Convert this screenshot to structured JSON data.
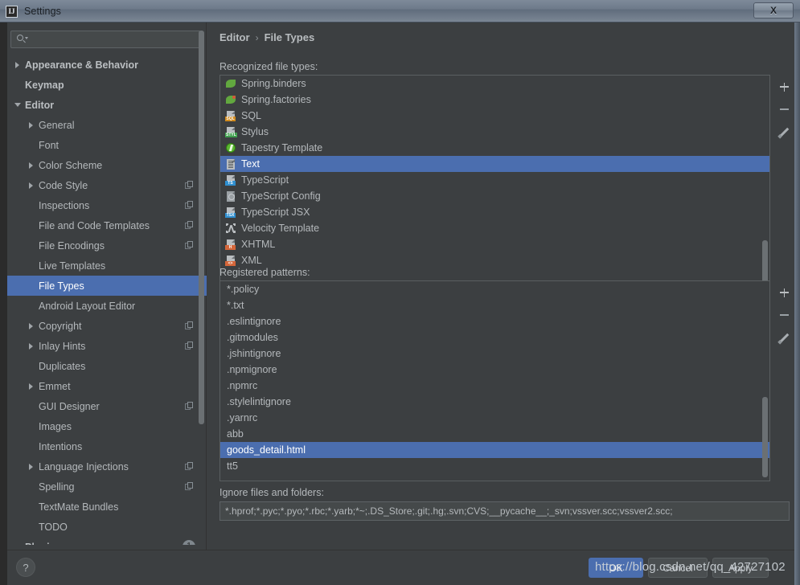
{
  "window": {
    "title": "Settings",
    "app_icon": "IJ",
    "close_label": "X"
  },
  "sidebar": {
    "search": {
      "value": "",
      "placeholder": ""
    },
    "items": [
      {
        "label": "Appearance & Behavior",
        "arrow": "collapsed",
        "indent": 0,
        "bold": true,
        "copy": false,
        "selected": false
      },
      {
        "label": "Keymap",
        "arrow": "none",
        "indent": 0,
        "bold": true,
        "copy": false,
        "selected": false
      },
      {
        "label": "Editor",
        "arrow": "expanded",
        "indent": 0,
        "bold": true,
        "copy": false,
        "selected": false
      },
      {
        "label": "General",
        "arrow": "collapsed",
        "indent": 1,
        "bold": false,
        "copy": false,
        "selected": false
      },
      {
        "label": "Font",
        "arrow": "none",
        "indent": 1,
        "bold": false,
        "copy": false,
        "selected": false
      },
      {
        "label": "Color Scheme",
        "arrow": "collapsed",
        "indent": 1,
        "bold": false,
        "copy": false,
        "selected": false
      },
      {
        "label": "Code Style",
        "arrow": "collapsed",
        "indent": 1,
        "bold": false,
        "copy": true,
        "selected": false
      },
      {
        "label": "Inspections",
        "arrow": "none",
        "indent": 1,
        "bold": false,
        "copy": true,
        "selected": false
      },
      {
        "label": "File and Code Templates",
        "arrow": "none",
        "indent": 1,
        "bold": false,
        "copy": true,
        "selected": false
      },
      {
        "label": "File Encodings",
        "arrow": "none",
        "indent": 1,
        "bold": false,
        "copy": true,
        "selected": false
      },
      {
        "label": "Live Templates",
        "arrow": "none",
        "indent": 1,
        "bold": false,
        "copy": false,
        "selected": false
      },
      {
        "label": "File Types",
        "arrow": "none",
        "indent": 1,
        "bold": false,
        "copy": false,
        "selected": true
      },
      {
        "label": "Android Layout Editor",
        "arrow": "none",
        "indent": 1,
        "bold": false,
        "copy": false,
        "selected": false
      },
      {
        "label": "Copyright",
        "arrow": "collapsed",
        "indent": 1,
        "bold": false,
        "copy": true,
        "selected": false
      },
      {
        "label": "Inlay Hints",
        "arrow": "collapsed",
        "indent": 1,
        "bold": false,
        "copy": true,
        "selected": false
      },
      {
        "label": "Duplicates",
        "arrow": "none",
        "indent": 1,
        "bold": false,
        "copy": false,
        "selected": false
      },
      {
        "label": "Emmet",
        "arrow": "collapsed",
        "indent": 1,
        "bold": false,
        "copy": false,
        "selected": false
      },
      {
        "label": "GUI Designer",
        "arrow": "none",
        "indent": 1,
        "bold": false,
        "copy": true,
        "selected": false
      },
      {
        "label": "Images",
        "arrow": "none",
        "indent": 1,
        "bold": false,
        "copy": false,
        "selected": false
      },
      {
        "label": "Intentions",
        "arrow": "none",
        "indent": 1,
        "bold": false,
        "copy": false,
        "selected": false
      },
      {
        "label": "Language Injections",
        "arrow": "collapsed",
        "indent": 1,
        "bold": false,
        "copy": true,
        "selected": false
      },
      {
        "label": "Spelling",
        "arrow": "none",
        "indent": 1,
        "bold": false,
        "copy": true,
        "selected": false
      },
      {
        "label": "TextMate Bundles",
        "arrow": "none",
        "indent": 1,
        "bold": false,
        "copy": false,
        "selected": false
      },
      {
        "label": "TODO",
        "arrow": "none",
        "indent": 1,
        "bold": false,
        "copy": false,
        "selected": false
      },
      {
        "label": "Plugins",
        "arrow": "none",
        "indent": 0,
        "bold": true,
        "copy": false,
        "selected": false,
        "badge": "1"
      }
    ]
  },
  "main": {
    "breadcrumb": {
      "parent": "Editor",
      "separator": "›",
      "current": "File Types"
    },
    "recognized_label": "Recognized file types:",
    "recognized_file_types": [
      {
        "name": "Spring.binders",
        "icon": "spring-leaf-icon",
        "tag": "",
        "tag_color": "#62a83f",
        "selected": false
      },
      {
        "name": "Spring.factories",
        "icon": "spring-leaf-dot-icon",
        "tag": "",
        "tag_color": "#62a83f",
        "selected": false
      },
      {
        "name": "SQL",
        "icon": "sql-file-icon",
        "tag": "SQL",
        "tag_color": "#d08a1d",
        "selected": false
      },
      {
        "name": "Stylus",
        "icon": "stylus-file-icon",
        "tag": "STYL",
        "tag_color": "#3f9e4d",
        "selected": false
      },
      {
        "name": "Tapestry Template",
        "icon": "tapestry-circle-icon",
        "tag": "",
        "tag_color": "#5bb731",
        "selected": false
      },
      {
        "name": "Text",
        "icon": "text-file-icon",
        "tag": "",
        "tag_color": "#9aa0a4",
        "selected": true
      },
      {
        "name": "TypeScript",
        "icon": "typescript-file-icon",
        "tag": "TS",
        "tag_color": "#2f8fd0",
        "selected": false
      },
      {
        "name": "TypeScript Config",
        "icon": "typescript-config-icon",
        "tag": "",
        "tag_color": "#8d9397",
        "selected": false
      },
      {
        "name": "TypeScript JSX",
        "icon": "typescript-jsx-icon",
        "tag": "TSX",
        "tag_color": "#2f8fd0",
        "selected": false
      },
      {
        "name": "Velocity Template",
        "icon": "velocity-icon",
        "tag": "",
        "tag_color": "#b9bdc0",
        "selected": false
      },
      {
        "name": "XHTML",
        "icon": "xhtml-file-icon",
        "tag": "H",
        "tag_color": "#d4663a",
        "selected": false
      },
      {
        "name": "XML",
        "icon": "xml-file-icon",
        "tag": "<>",
        "tag_color": "#d4663a",
        "selected": false
      }
    ],
    "recognized_buttons": [
      {
        "name": "add",
        "icon": "plus-icon"
      },
      {
        "name": "remove",
        "icon": "minus-icon"
      },
      {
        "name": "edit",
        "icon": "pencil-icon"
      }
    ],
    "registered_label": "Registered patterns:",
    "registered_patterns": [
      {
        "pattern": "*.policy",
        "selected": false
      },
      {
        "pattern": "*.txt",
        "selected": false
      },
      {
        "pattern": ".eslintignore",
        "selected": false
      },
      {
        "pattern": ".gitmodules",
        "selected": false
      },
      {
        "pattern": ".jshintignore",
        "selected": false
      },
      {
        "pattern": ".npmignore",
        "selected": false
      },
      {
        "pattern": ".npmrc",
        "selected": false
      },
      {
        "pattern": ".stylelintignore",
        "selected": false
      },
      {
        "pattern": ".yarnrc",
        "selected": false
      },
      {
        "pattern": "abb",
        "selected": false
      },
      {
        "pattern": "goods_detail.html",
        "selected": true
      },
      {
        "pattern": "tt5",
        "selected": false
      }
    ],
    "registered_buttons": [
      {
        "name": "add",
        "icon": "plus-icon"
      },
      {
        "name": "remove",
        "icon": "minus-icon"
      },
      {
        "name": "edit",
        "icon": "pencil-icon"
      }
    ],
    "ignore_label": "Ignore files and folders:",
    "ignore_value": "*.hprof;*.pyc;*.pyo;*.rbc;*.yarb;*~;.DS_Store;.git;.hg;.svn;CVS;__pycache__;_svn;vssver.scc;vssver2.scc;"
  },
  "footer": {
    "help_label": "?",
    "ok_label": "OK",
    "cancel_label": "Cancel",
    "apply_label": "Apply",
    "watermark": "https://blog.csdn.net/qq_42727102"
  },
  "colors": {
    "accent_selection": "#4b6eaf",
    "panel_background": "#3c3f41",
    "field_background": "#45494a",
    "text_primary": "#b4b8bb",
    "border": "#5a5f61"
  }
}
